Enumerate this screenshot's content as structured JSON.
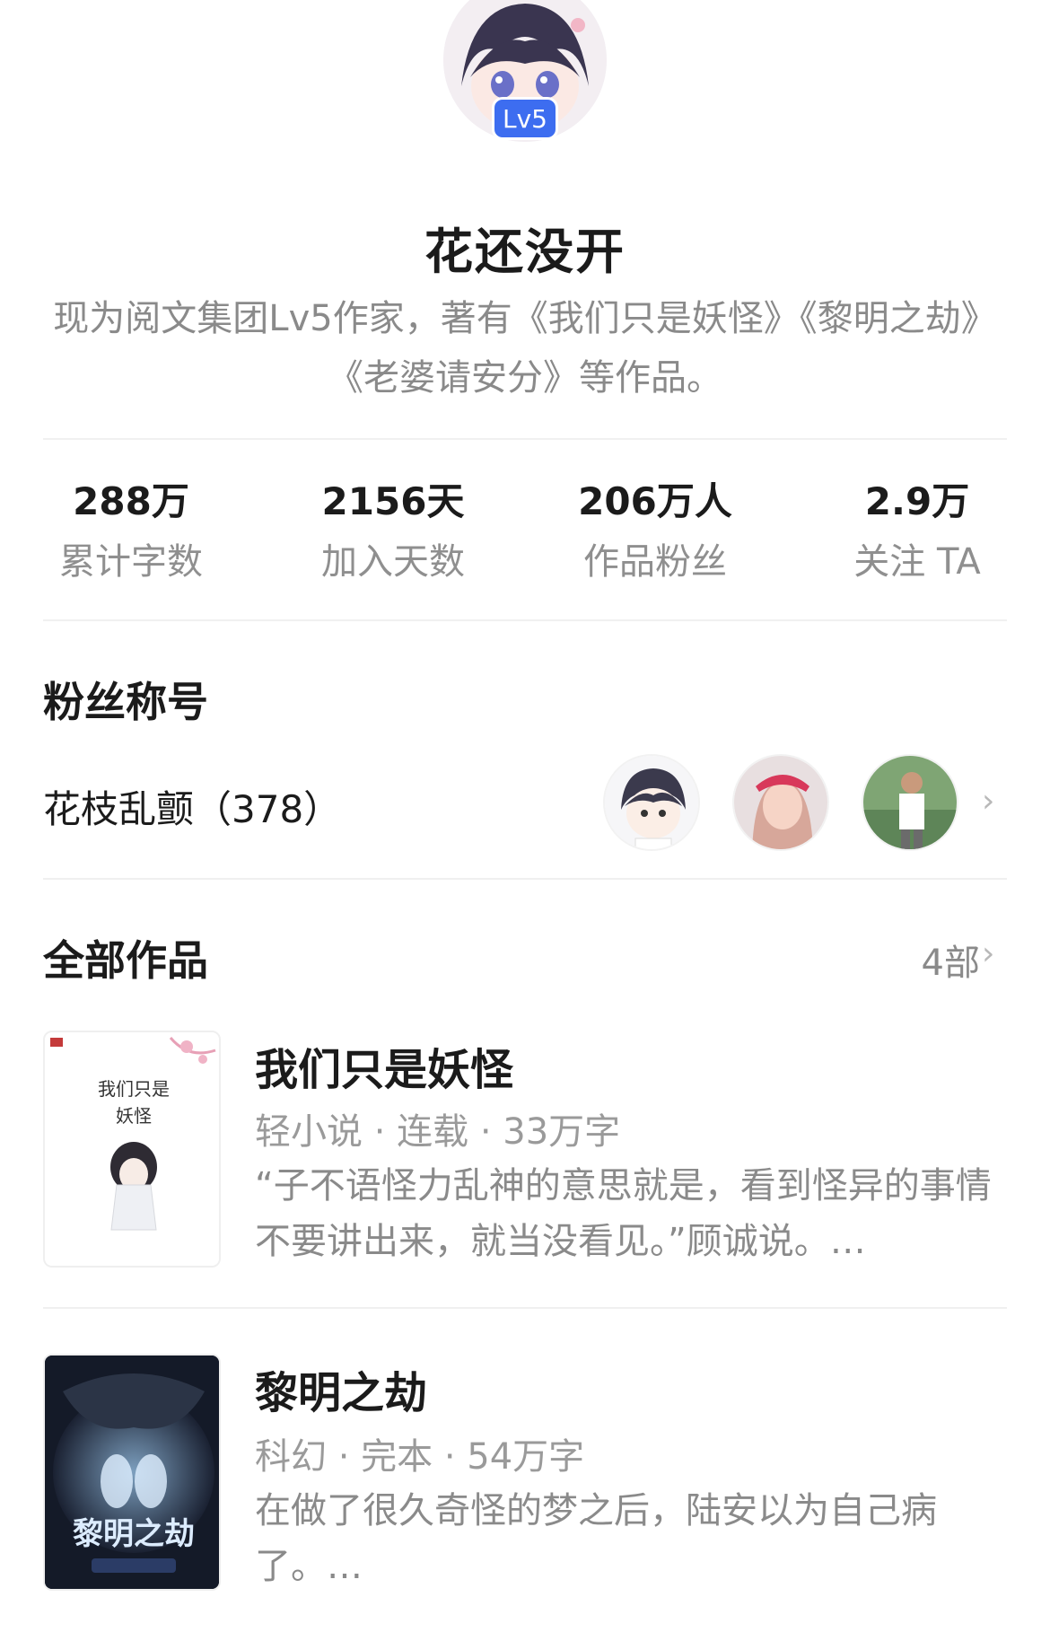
{
  "profile": {
    "level_badge": "Lv5",
    "name": "花还没开",
    "bio": "现为阅文集团Lv5作家，著有《我们只是妖怪》《黎明之劫》《老婆请安分》等作品。"
  },
  "stats": [
    {
      "value": "288万",
      "label": "累计字数"
    },
    {
      "value": "2156天",
      "label": "加入天数"
    },
    {
      "value": "206万人",
      "label": "作品粉丝"
    },
    {
      "value": "2.9万",
      "label": "关注 TA"
    }
  ],
  "fan_title": {
    "heading": "粉丝称号",
    "name": "花枝乱颤（378）"
  },
  "works": {
    "heading": "全部作品",
    "count": "4部",
    "books": [
      {
        "title": "我们只是妖怪",
        "meta": "轻小说 · 连载 · 33万字",
        "desc": "“子不语怪力乱神的意思就是，看到怪异的事情不要讲出来，就当没看见。”顾诚说。…",
        "cover_text": "我们只是妖怪"
      },
      {
        "title": "黎明之劫",
        "meta": "科幻 · 完本 · 54万字",
        "desc": "在做了很久奇怪的梦之后，陆安以为自己病了。…",
        "cover_text": "黎明之劫"
      }
    ]
  },
  "colors": {
    "accent": "#3d6df0",
    "text_primary": "#1b1b1b",
    "text_secondary": "#8a8a8a"
  }
}
